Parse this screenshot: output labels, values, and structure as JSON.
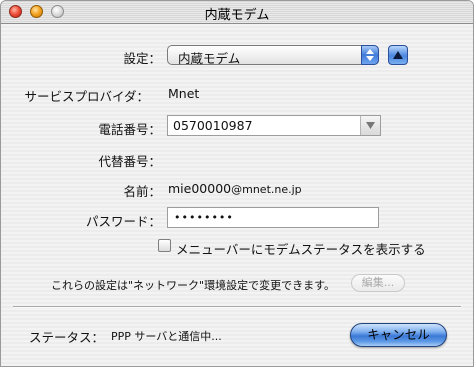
{
  "window": {
    "title": "内蔵モデム"
  },
  "form": {
    "settings_label": "設定：",
    "settings_value": "内蔵モデム",
    "provider_label": "サービスプロバイダ：",
    "provider_value": "Mnet",
    "phone_label": "電話番号：",
    "phone_value": "0570010987",
    "alt_phone_label": "代替番号：",
    "name_label": "名前：",
    "name_value": "mie00000",
    "name_suffix": "@mnet.ne.jp",
    "password_label": "パスワード：",
    "password_value": "••••••••",
    "menubar_checkbox_label": "メニューバーにモデムステータスを表示する",
    "menubar_checkbox_checked": false
  },
  "footer": {
    "note": "これらの設定は\"ネットワーク\"環境設定で変更できます。",
    "edit_button": "編集...",
    "status_label": "ステータス：",
    "status_value": "PPP サーバと通信中...",
    "cancel_button": "キャンセル"
  },
  "icons": {
    "close": "close-light-icon",
    "minimize": "minimize-light-icon",
    "zoom": "zoom-light-icon",
    "popup_arrows": "updown-arrows-icon",
    "disclosure": "triangle-up-icon",
    "combo_arrow": "triangle-down-icon"
  },
  "colors": {
    "accent": "#3f7bd9",
    "close_light": "#f0523e",
    "minimize_light": "#f5a623",
    "zoom_light": "#dcdcdc"
  }
}
